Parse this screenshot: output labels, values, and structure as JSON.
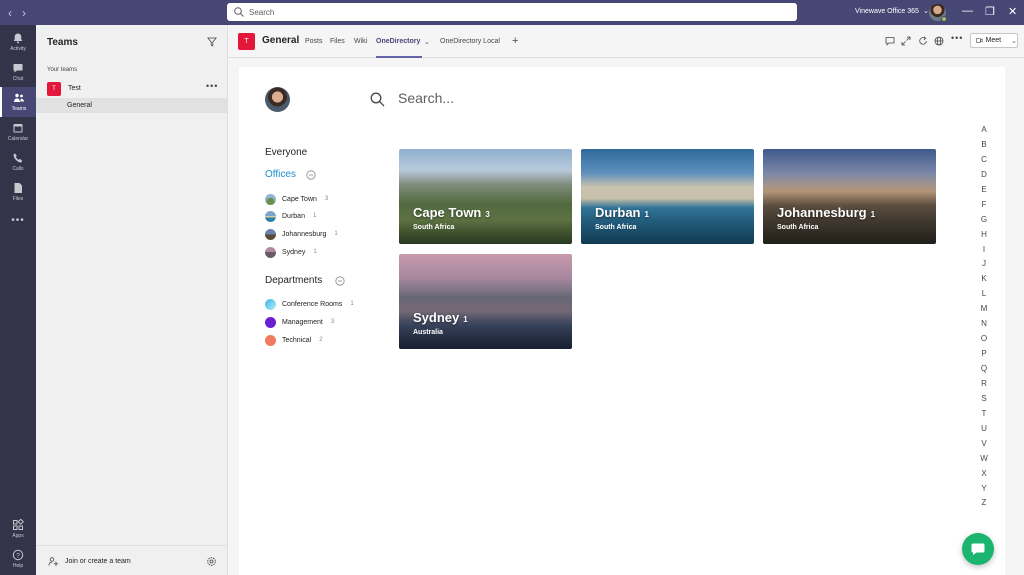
{
  "titlebar": {
    "search_placeholder": "Search",
    "tenant": "Vinewave Office 365",
    "tenant_chevron": "⌄"
  },
  "appbar": {
    "items": [
      {
        "label": "Activity",
        "icon": "bell-icon"
      },
      {
        "label": "Chat",
        "icon": "chat-icon"
      },
      {
        "label": "Teams",
        "icon": "teams-icon"
      },
      {
        "label": "Calendar",
        "icon": "calendar-icon"
      },
      {
        "label": "Calls",
        "icon": "phone-icon"
      },
      {
        "label": "Files",
        "icon": "file-icon"
      }
    ],
    "more": "•••",
    "apps_label": "Apps",
    "help_label": "Help"
  },
  "teams_panel": {
    "title": "Teams",
    "section_label": "Your teams",
    "team": {
      "initial": "T",
      "name": "Test",
      "more": "•••"
    },
    "channel": "General",
    "footer_label": "Join or create a team"
  },
  "channel_header": {
    "initial": "T",
    "title": "General",
    "tabs": [
      "Posts",
      "Files",
      "Wiki",
      "OneDirectory",
      "OneDirectory Local"
    ],
    "add_tab": "+",
    "meet_label": "Meet"
  },
  "directory": {
    "search_placeholder": "Search...",
    "everyone_label": "Everyone",
    "offices_heading": "Offices",
    "offices": [
      {
        "name": "Cape Town",
        "count": "3"
      },
      {
        "name": "Durban",
        "count": "1"
      },
      {
        "name": "Johannesburg",
        "count": "1"
      },
      {
        "name": "Sydney",
        "count": "1"
      }
    ],
    "departments_heading": "Departments",
    "departments": [
      {
        "name": "Conference Rooms",
        "count": "1",
        "color": "#3bb4e8"
      },
      {
        "name": "Management",
        "count": "3",
        "color": "#6a1fd1"
      },
      {
        "name": "Technical",
        "count": "2",
        "color": "#f07a5e"
      }
    ],
    "cards": [
      {
        "city": "Cape Town",
        "count": "3",
        "country": "South Africa"
      },
      {
        "city": "Durban",
        "count": "1",
        "country": "South Africa"
      },
      {
        "city": "Johannesburg",
        "count": "1",
        "country": "South Africa"
      },
      {
        "city": "Sydney",
        "count": "1",
        "country": "Australia"
      }
    ],
    "alphabet": [
      "A",
      "B",
      "C",
      "D",
      "E",
      "F",
      "G",
      "H",
      "I",
      "J",
      "K",
      "L",
      "M",
      "N",
      "O",
      "P",
      "Q",
      "R",
      "S",
      "T",
      "U",
      "V",
      "W",
      "X",
      "Y",
      "Z"
    ]
  },
  "colors": {
    "titlebar": "#464775",
    "appbar": "#33344a",
    "team_tile": "#e3173a",
    "accent": "#6264a7",
    "active_filter": "#1e8fd4",
    "chat_fab": "#1bb56f"
  }
}
